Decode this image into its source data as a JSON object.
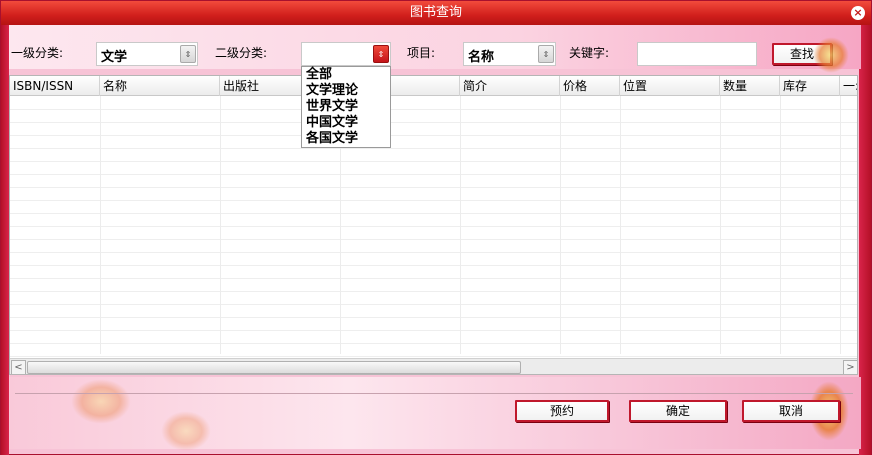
{
  "window": {
    "title": "图书查询",
    "close": "×"
  },
  "filters": {
    "level1_label": "一级分类:",
    "level1_value": "文学",
    "level2_label": "二级分类:",
    "level2_value": "",
    "field_label": "项目:",
    "field_value": "名称",
    "keyword_label": "关键字:",
    "keyword_value": "",
    "search_button": "查找"
  },
  "level2_options": [
    "全部",
    "文学理论",
    "世界文学",
    "中国文学",
    "各国文学"
  ],
  "table": {
    "columns": [
      "ISBN/ISSN",
      "名称",
      "出版社",
      "",
      "简介",
      "价格",
      "位置",
      "数量",
      "库存",
      "一:"
    ],
    "rows": []
  },
  "icons": {
    "scroll_left": "<",
    "scroll_right": ">",
    "combo_arrow": "⇕"
  },
  "actions": {
    "reserve": "预约",
    "confirm": "确定",
    "cancel": "取消"
  },
  "colors": {
    "title_bar": "#d11f1c",
    "frame": "#b41027",
    "button_border": "#c0182c",
    "panel": "#f7c3d6"
  }
}
